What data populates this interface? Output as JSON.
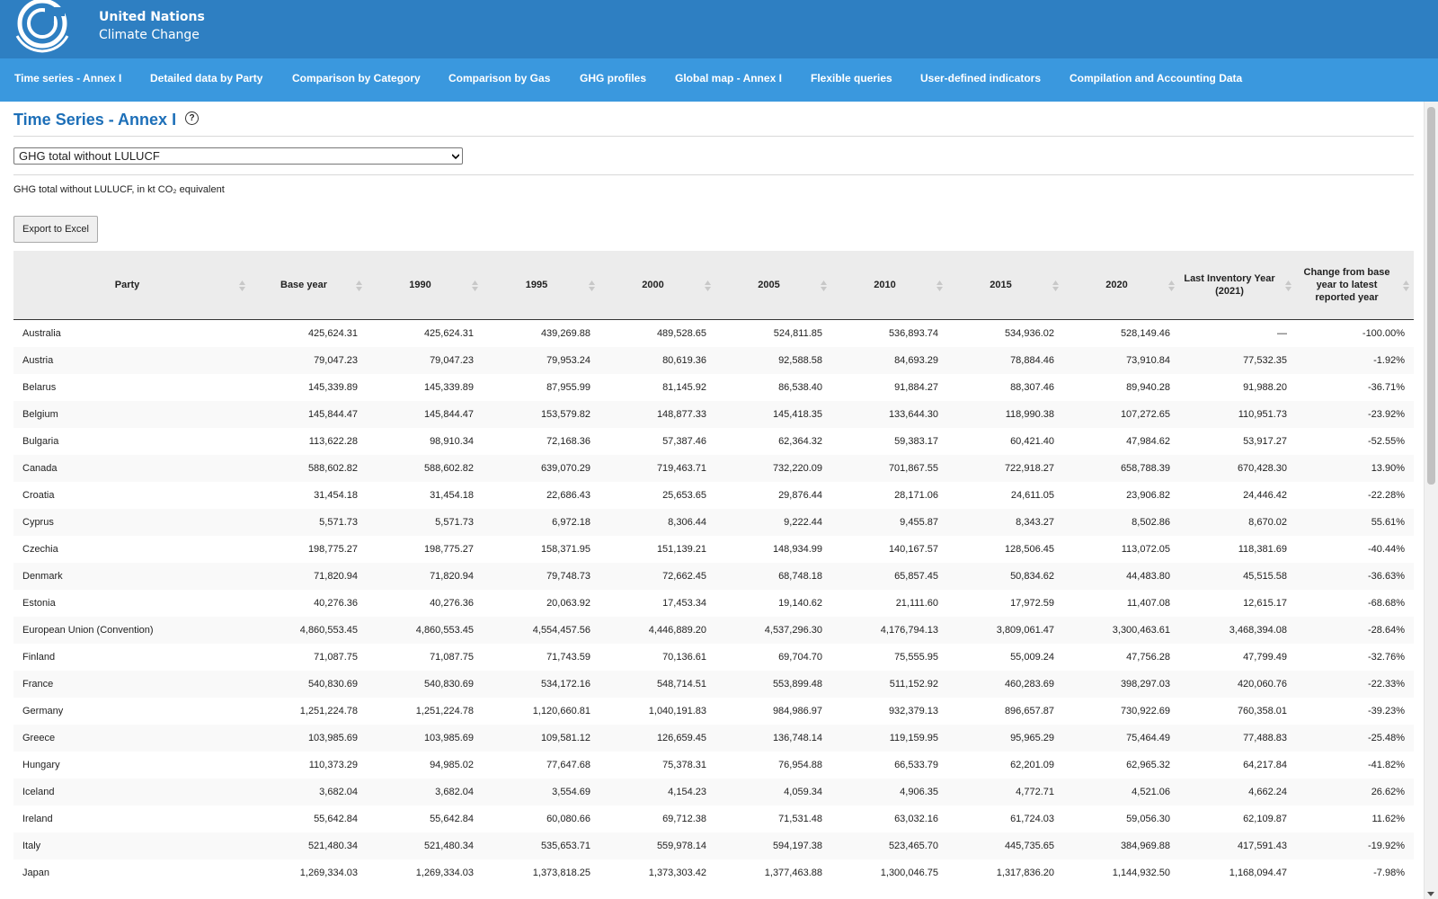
{
  "brand": {
    "line1": "United Nations",
    "line2": "Climate Change",
    "logo_icon": "unfccc-logo-icon"
  },
  "nav": [
    "Time series - Annex I",
    "Detailed data by Party",
    "Comparison by Category",
    "Comparison by Gas",
    "GHG profiles",
    "Global map - Annex I",
    "Flexible queries",
    "User-defined indicators",
    "Compilation and Accounting Data"
  ],
  "page": {
    "title": "Time Series - Annex I",
    "help_icon": "?",
    "select_value": "GHG total without LULUCF",
    "subtitle": "GHG total without LULUCF, in kt CO₂ equivalent",
    "export_label": "Export to Excel"
  },
  "table": {
    "headers": [
      "Party",
      "Base year",
      "1990",
      "1995",
      "2000",
      "2005",
      "2010",
      "2015",
      "2020",
      "Last Inventory Year (2021)",
      "Change from base year to latest reported year"
    ],
    "rows": [
      [
        "Australia",
        "425,624.31",
        "425,624.31",
        "439,269.88",
        "489,528.65",
        "524,811.85",
        "536,893.74",
        "534,936.02",
        "528,149.46",
        "—",
        "-100.00%"
      ],
      [
        "Austria",
        "79,047.23",
        "79,047.23",
        "79,953.24",
        "80,619.36",
        "92,588.58",
        "84,693.29",
        "78,884.46",
        "73,910.84",
        "77,532.35",
        "-1.92%"
      ],
      [
        "Belarus",
        "145,339.89",
        "145,339.89",
        "87,955.99",
        "81,145.92",
        "86,538.40",
        "91,884.27",
        "88,307.46",
        "89,940.28",
        "91,988.20",
        "-36.71%"
      ],
      [
        "Belgium",
        "145,844.47",
        "145,844.47",
        "153,579.82",
        "148,877.33",
        "145,418.35",
        "133,644.30",
        "118,990.38",
        "107,272.65",
        "110,951.73",
        "-23.92%"
      ],
      [
        "Bulgaria",
        "113,622.28",
        "98,910.34",
        "72,168.36",
        "57,387.46",
        "62,364.32",
        "59,383.17",
        "60,421.40",
        "47,984.62",
        "53,917.27",
        "-52.55%"
      ],
      [
        "Canada",
        "588,602.82",
        "588,602.82",
        "639,070.29",
        "719,463.71",
        "732,220.09",
        "701,867.55",
        "722,918.27",
        "658,788.39",
        "670,428.30",
        "13.90%"
      ],
      [
        "Croatia",
        "31,454.18",
        "31,454.18",
        "22,686.43",
        "25,653.65",
        "29,876.44",
        "28,171.06",
        "24,611.05",
        "23,906.82",
        "24,446.42",
        "-22.28%"
      ],
      [
        "Cyprus",
        "5,571.73",
        "5,571.73",
        "6,972.18",
        "8,306.44",
        "9,222.44",
        "9,455.87",
        "8,343.27",
        "8,502.86",
        "8,670.02",
        "55.61%"
      ],
      [
        "Czechia",
        "198,775.27",
        "198,775.27",
        "158,371.95",
        "151,139.21",
        "148,934.99",
        "140,167.57",
        "128,506.45",
        "113,072.05",
        "118,381.69",
        "-40.44%"
      ],
      [
        "Denmark",
        "71,820.94",
        "71,820.94",
        "79,748.73",
        "72,662.45",
        "68,748.18",
        "65,857.45",
        "50,834.62",
        "44,483.80",
        "45,515.58",
        "-36.63%"
      ],
      [
        "Estonia",
        "40,276.36",
        "40,276.36",
        "20,063.92",
        "17,453.34",
        "19,140.62",
        "21,111.60",
        "17,972.59",
        "11,407.08",
        "12,615.17",
        "-68.68%"
      ],
      [
        "European Union (Convention)",
        "4,860,553.45",
        "4,860,553.45",
        "4,554,457.56",
        "4,446,889.20",
        "4,537,296.30",
        "4,176,794.13",
        "3,809,061.47",
        "3,300,463.61",
        "3,468,394.08",
        "-28.64%"
      ],
      [
        "Finland",
        "71,087.75",
        "71,087.75",
        "71,743.59",
        "70,136.61",
        "69,704.70",
        "75,555.95",
        "55,009.24",
        "47,756.28",
        "47,799.49",
        "-32.76%"
      ],
      [
        "France",
        "540,830.69",
        "540,830.69",
        "534,172.16",
        "548,714.51",
        "553,899.48",
        "511,152.92",
        "460,283.69",
        "398,297.03",
        "420,060.76",
        "-22.33%"
      ],
      [
        "Germany",
        "1,251,224.78",
        "1,251,224.78",
        "1,120,660.81",
        "1,040,191.83",
        "984,986.97",
        "932,379.13",
        "896,657.87",
        "730,922.69",
        "760,358.01",
        "-39.23%"
      ],
      [
        "Greece",
        "103,985.69",
        "103,985.69",
        "109,581.12",
        "126,659.45",
        "136,748.14",
        "119,159.95",
        "95,965.29",
        "75,464.49",
        "77,488.83",
        "-25.48%"
      ],
      [
        "Hungary",
        "110,373.29",
        "94,985.02",
        "77,647.68",
        "75,378.31",
        "76,954.88",
        "66,533.79",
        "62,201.09",
        "62,965.32",
        "64,217.84",
        "-41.82%"
      ],
      [
        "Iceland",
        "3,682.04",
        "3,682.04",
        "3,554.69",
        "4,154.23",
        "4,059.34",
        "4,906.35",
        "4,772.71",
        "4,521.06",
        "4,662.24",
        "26.62%"
      ],
      [
        "Ireland",
        "55,642.84",
        "55,642.84",
        "60,080.66",
        "69,712.38",
        "71,531.48",
        "63,032.16",
        "61,724.03",
        "59,056.30",
        "62,109.87",
        "11.62%"
      ],
      [
        "Italy",
        "521,480.34",
        "521,480.34",
        "535,653.71",
        "559,978.14",
        "594,197.38",
        "523,465.70",
        "445,735.65",
        "384,969.88",
        "417,591.43",
        "-19.92%"
      ],
      [
        "Japan",
        "1,269,334.03",
        "1,269,334.03",
        "1,373,818.25",
        "1,373,303.42",
        "1,377,463.88",
        "1,300,046.75",
        "1,317,836.20",
        "1,144,932.50",
        "1,168,094.47",
        "-7.98%"
      ]
    ]
  },
  "colors": {
    "topbar": "#2e7fc2",
    "navbar": "#3a98de",
    "title": "#1d6fb8"
  }
}
